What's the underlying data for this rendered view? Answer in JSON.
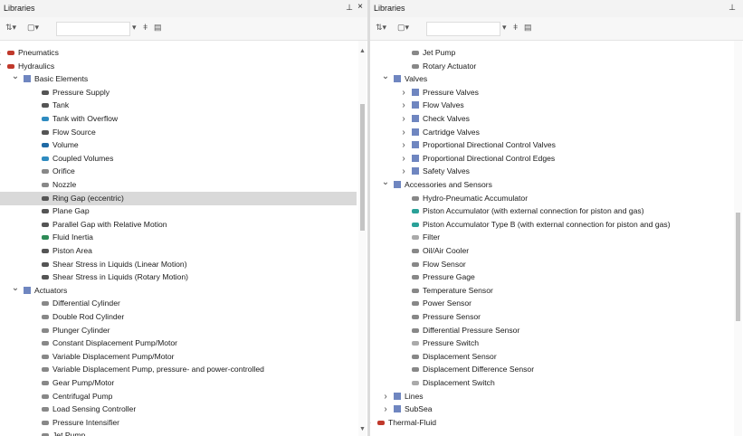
{
  "left": {
    "title": "Libraries",
    "pin": "⊥",
    "close": "×",
    "items": [
      {
        "label": "Pneumatics",
        "level": 1,
        "chev": "right",
        "icon": "pneumatics-icon",
        "color": "#c0392b"
      },
      {
        "label": "Hydraulics",
        "level": 1,
        "chev": "down",
        "icon": "hydraulics-icon",
        "color": "#c0392b"
      },
      {
        "label": "Basic Elements",
        "level": 2,
        "chev": "down",
        "icon": "folder-icon",
        "color": "#6f86c0"
      },
      {
        "label": "Pressure Supply",
        "level": 3,
        "icon": "pressure-supply-icon",
        "color": "#555"
      },
      {
        "label": "Tank",
        "level": 3,
        "icon": "tank-icon",
        "color": "#555"
      },
      {
        "label": "Tank with Overflow",
        "level": 3,
        "icon": "tank-overflow-icon",
        "color": "#2e8bc0"
      },
      {
        "label": "Flow Source",
        "level": 3,
        "icon": "flow-source-icon",
        "color": "#555"
      },
      {
        "label": "Volume",
        "level": 3,
        "icon": "volume-icon",
        "color": "#1f6aa5"
      },
      {
        "label": "Coupled Volumes",
        "level": 3,
        "icon": "coupled-volumes-icon",
        "color": "#2e8bc0"
      },
      {
        "label": "Orifice",
        "level": 3,
        "icon": "orifice-icon",
        "color": "#888"
      },
      {
        "label": "Nozzle",
        "level": 3,
        "icon": "nozzle-icon",
        "color": "#888"
      },
      {
        "label": "Ring Gap (eccentric)",
        "level": 3,
        "icon": "ring-gap-icon",
        "color": "#555",
        "selected": true
      },
      {
        "label": "Plane Gap",
        "level": 3,
        "icon": "plane-gap-icon",
        "color": "#555"
      },
      {
        "label": "Parallel Gap with Relative Motion",
        "level": 3,
        "icon": "parallel-gap-icon",
        "color": "#555"
      },
      {
        "label": "Fluid Inertia",
        "level": 3,
        "icon": "fluid-inertia-icon",
        "color": "#2e8b57"
      },
      {
        "label": "Piston Area",
        "level": 3,
        "icon": "piston-area-icon",
        "color": "#555"
      },
      {
        "label": "Shear Stress in Liquids (Linear Motion)",
        "level": 3,
        "icon": "shear-linear-icon",
        "color": "#555"
      },
      {
        "label": "Shear Stress in Liquids (Rotary Motion)",
        "level": 3,
        "icon": "shear-rotary-icon",
        "color": "#555"
      },
      {
        "label": "Actuators",
        "level": 2,
        "chev": "down",
        "icon": "folder-icon",
        "color": "#6f86c0"
      },
      {
        "label": "Differential Cylinder",
        "level": 3,
        "icon": "cylinder-icon",
        "color": "#888"
      },
      {
        "label": "Double Rod Cylinder",
        "level": 3,
        "icon": "cylinder-icon",
        "color": "#888"
      },
      {
        "label": "Plunger Cylinder",
        "level": 3,
        "icon": "cylinder-icon",
        "color": "#888"
      },
      {
        "label": "Constant Displacement Pump/Motor",
        "level": 3,
        "icon": "pump-icon",
        "color": "#888"
      },
      {
        "label": "Variable Displacement Pump/Motor",
        "level": 3,
        "icon": "pump-icon",
        "color": "#888"
      },
      {
        "label": "Variable Displacement Pump, pressure- and power-controlled",
        "level": 3,
        "icon": "pump-icon",
        "color": "#888"
      },
      {
        "label": "Gear Pump/Motor",
        "level": 3,
        "icon": "gear-pump-icon",
        "color": "#888"
      },
      {
        "label": "Centrifugal Pump",
        "level": 3,
        "icon": "centrifugal-pump-icon",
        "color": "#888"
      },
      {
        "label": "Load Sensing Controller",
        "level": 3,
        "icon": "controller-icon",
        "color": "#888"
      },
      {
        "label": "Pressure Intensifier",
        "level": 3,
        "icon": "intensifier-icon",
        "color": "#888"
      },
      {
        "label": "Jet Pump",
        "level": 3,
        "icon": "jet-pump-icon",
        "color": "#888"
      }
    ]
  },
  "right": {
    "title": "Libraries",
    "pin": "⊥",
    "items": [
      {
        "label": "Jet Pump",
        "level": 3,
        "icon": "jet-pump-icon",
        "color": "#888"
      },
      {
        "label": "Rotary Actuator",
        "level": 3,
        "icon": "rotary-actuator-icon",
        "color": "#888"
      },
      {
        "label": "Valves",
        "level": 2,
        "chev": "down",
        "icon": "folder-icon",
        "color": "#6f86c0"
      },
      {
        "label": "Pressure Valves",
        "level": 3,
        "chev": "right",
        "icon": "folder-icon",
        "color": "#6f86c0"
      },
      {
        "label": "Flow Valves",
        "level": 3,
        "chev": "right",
        "icon": "folder-icon",
        "color": "#6f86c0"
      },
      {
        "label": "Check Valves",
        "level": 3,
        "chev": "right",
        "icon": "folder-icon",
        "color": "#6f86c0"
      },
      {
        "label": "Cartridge Valves",
        "level": 3,
        "chev": "right",
        "icon": "folder-icon",
        "color": "#6f86c0"
      },
      {
        "label": "Proportional Directional Control Valves",
        "level": 3,
        "chev": "right",
        "icon": "folder-icon",
        "color": "#6f86c0"
      },
      {
        "label": "Proportional Directional Control Edges",
        "level": 3,
        "chev": "right",
        "icon": "folder-icon",
        "color": "#6f86c0"
      },
      {
        "label": "Safety Valves",
        "level": 3,
        "chev": "right",
        "icon": "folder-icon",
        "color": "#6f86c0"
      },
      {
        "label": "Accessories and Sensors",
        "level": 2,
        "chev": "down",
        "icon": "folder-icon",
        "color": "#6f86c0"
      },
      {
        "label": "Hydro-Pneumatic Accumulator",
        "level": 3,
        "icon": "accumulator-icon",
        "color": "#888"
      },
      {
        "label": "Piston Accumulator (with external connection for piston and gas)",
        "level": 3,
        "icon": "piston-accumulator-icon",
        "color": "#2aa198"
      },
      {
        "label": "Piston Accumulator Type B (with external connection for piston and gas)",
        "level": 3,
        "icon": "piston-accumulator-icon",
        "color": "#2aa198"
      },
      {
        "label": "Filter",
        "level": 3,
        "icon": "filter-icon",
        "color": "#aaa"
      },
      {
        "label": "Oil/Air Cooler",
        "level": 3,
        "icon": "cooler-icon",
        "color": "#888"
      },
      {
        "label": "Flow Sensor",
        "level": 3,
        "icon": "flow-sensor-icon",
        "color": "#888"
      },
      {
        "label": "Pressure Gage",
        "level": 3,
        "icon": "pressure-gage-icon",
        "color": "#888"
      },
      {
        "label": "Temperature Sensor",
        "level": 3,
        "icon": "temperature-sensor-icon",
        "color": "#888"
      },
      {
        "label": "Power Sensor",
        "level": 3,
        "icon": "power-sensor-icon",
        "color": "#888"
      },
      {
        "label": "Pressure Sensor",
        "level": 3,
        "icon": "pressure-sensor-icon",
        "color": "#888"
      },
      {
        "label": "Differential Pressure Sensor",
        "level": 3,
        "icon": "differential-pressure-sensor-icon",
        "color": "#888"
      },
      {
        "label": "Pressure Switch",
        "level": 3,
        "icon": "pressure-switch-icon",
        "color": "#aaa"
      },
      {
        "label": "Displacement Sensor",
        "level": 3,
        "icon": "displacement-sensor-icon",
        "color": "#888"
      },
      {
        "label": "Displacement Difference Sensor",
        "level": 3,
        "icon": "displacement-difference-sensor-icon",
        "color": "#888"
      },
      {
        "label": "Displacement Switch",
        "level": 3,
        "icon": "displacement-switch-icon",
        "color": "#aaa"
      },
      {
        "label": "Lines",
        "level": 2,
        "chev": "right",
        "icon": "folder-icon",
        "color": "#6f86c0"
      },
      {
        "label": "SubSea",
        "level": 2,
        "chev": "right",
        "icon": "folder-icon",
        "color": "#6f86c0"
      },
      {
        "label": "Thermal-Fluid",
        "level": 1,
        "chev": "right",
        "icon": "thermal-fluid-icon",
        "color": "#c0392b"
      }
    ]
  }
}
